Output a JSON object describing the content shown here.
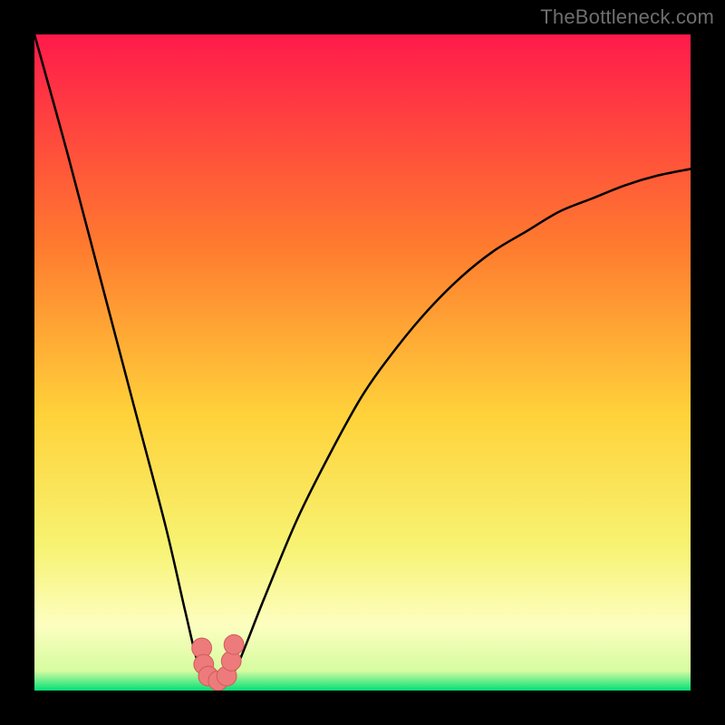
{
  "watermark": "TheBottleneck.com",
  "colors": {
    "bg": "#000000",
    "grad_top": "#ff1a4b",
    "grad_mid1": "#ff7a2f",
    "grad_mid2": "#ffd23a",
    "grad_mid3": "#f7f372",
    "grad_low": "#fdfec0",
    "grad_bottom": "#00e076",
    "curve": "#000000",
    "marker_fill": "#ed7b7b",
    "marker_stroke": "#d25e5e"
  },
  "chart_data": {
    "type": "line",
    "title": "",
    "xlabel": "",
    "ylabel": "",
    "xlim": [
      0,
      100
    ],
    "ylim": [
      0,
      100
    ],
    "grid": false,
    "series": [
      {
        "name": "bottleneck-curve",
        "x": [
          0,
          5,
          10,
          15,
          20,
          23,
          25,
          27,
          28,
          29,
          31,
          35,
          40,
          45,
          50,
          55,
          60,
          65,
          70,
          75,
          80,
          85,
          90,
          95,
          100
        ],
        "y": [
          100,
          82,
          63,
          44,
          25,
          12,
          4,
          1,
          0,
          1,
          4,
          14,
          26,
          36,
          45,
          52,
          58,
          63,
          67,
          70,
          73,
          75,
          77,
          78.5,
          79.5
        ]
      }
    ],
    "markers": {
      "name": "highlight-cluster",
      "points": [
        {
          "x": 25.5,
          "y": 6.5
        },
        {
          "x": 25.8,
          "y": 4.0
        },
        {
          "x": 26.5,
          "y": 2.2
        },
        {
          "x": 28.0,
          "y": 1.5
        },
        {
          "x": 29.3,
          "y": 2.2
        },
        {
          "x": 30.0,
          "y": 4.5
        },
        {
          "x": 30.4,
          "y": 7.0
        }
      ],
      "radius_pct": 1.5
    }
  }
}
